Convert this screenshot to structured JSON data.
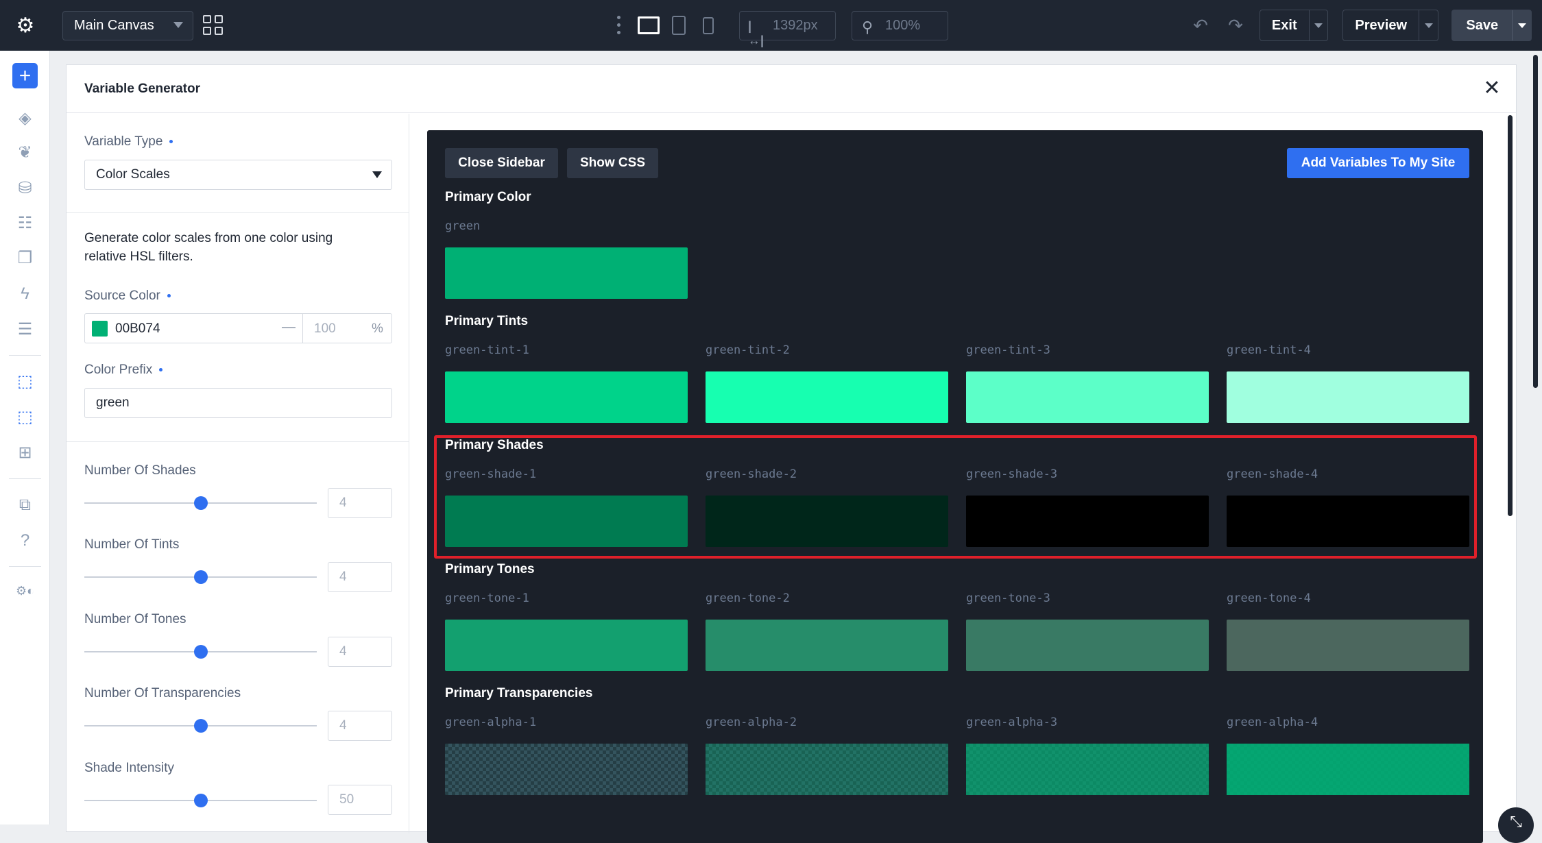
{
  "topbar": {
    "canvas_label": "Main Canvas",
    "width_value": "1392px",
    "zoom_value": "100%",
    "exit_label": "Exit",
    "preview_label": "Preview",
    "save_label": "Save"
  },
  "panel": {
    "title": "Variable Generator",
    "close_glyph": "✕"
  },
  "sidebar": {
    "variable_type_label": "Variable Type",
    "variable_type_value": "Color Scales",
    "description": "Generate color scales from one color using relative HSL filters.",
    "source_color_label": "Source Color",
    "source_hex": "00B074",
    "source_dash": "—",
    "source_alpha_placeholder": "100",
    "source_alpha_unit": "%",
    "color_prefix_label": "Color Prefix",
    "color_prefix_value": "green",
    "sliders": [
      {
        "label": "Number Of Shades",
        "value": "4"
      },
      {
        "label": "Number Of Tints",
        "value": "4"
      },
      {
        "label": "Number Of Tones",
        "value": "4"
      },
      {
        "label": "Number Of Transparencies",
        "value": "4"
      },
      {
        "label": "Shade Intensity",
        "value": "50"
      }
    ]
  },
  "preview": {
    "close_sidebar_label": "Close Sidebar",
    "show_css_label": "Show CSS",
    "add_variables_label": "Add Variables To My Site",
    "primary_title": "Primary Color",
    "primary_name": "green",
    "primary_color": "#00b074",
    "tints_title": "Primary Tints",
    "tints": [
      {
        "name": "green-tint-1",
        "color": "#00d38a"
      },
      {
        "name": "green-tint-2",
        "color": "#17ffb0"
      },
      {
        "name": "green-tint-3",
        "color": "#5cffc8"
      },
      {
        "name": "green-tint-4",
        "color": "#a0ffdf"
      }
    ],
    "shades_title": "Primary Shades",
    "shades": [
      {
        "name": "green-shade-1",
        "color": "#007b51"
      },
      {
        "name": "green-shade-2",
        "color": "#00261a"
      },
      {
        "name": "green-shade-3",
        "color": "#000000"
      },
      {
        "name": "green-shade-4",
        "color": "#000000"
      }
    ],
    "tones_title": "Primary Tones",
    "tones": [
      {
        "name": "green-tone-1",
        "color": "#13a06f"
      },
      {
        "name": "green-tone-2",
        "color": "#268d6a"
      },
      {
        "name": "green-tone-3",
        "color": "#397a64"
      },
      {
        "name": "green-tone-4",
        "color": "#4c675e"
      }
    ],
    "transparencies_title": "Primary Transparencies",
    "transparencies": [
      {
        "name": "green-alpha-1",
        "color": "rgba(0,176,116,0.1)"
      },
      {
        "name": "green-alpha-2",
        "color": "rgba(0,176,116,0.4)"
      },
      {
        "name": "green-alpha-3",
        "color": "rgba(0,176,116,0.7)"
      },
      {
        "name": "green-alpha-4",
        "color": "rgba(0,176,116,0.9)"
      }
    ]
  },
  "colors": {
    "accent": "#2f6ff0",
    "highlight": "#e0202a"
  }
}
